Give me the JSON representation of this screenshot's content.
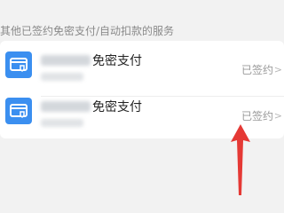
{
  "section": {
    "title": "其他已签约免密支付/自动扣款的服务"
  },
  "services": [
    {
      "label": "免密支付",
      "status": "已签约",
      "icon": "card-shield-icon"
    },
    {
      "label": "免密支付",
      "status": "已签约",
      "icon": "card-shield-icon"
    }
  ],
  "colors": {
    "accent": "#3b8ff0",
    "annotation_arrow": "#e53935"
  }
}
